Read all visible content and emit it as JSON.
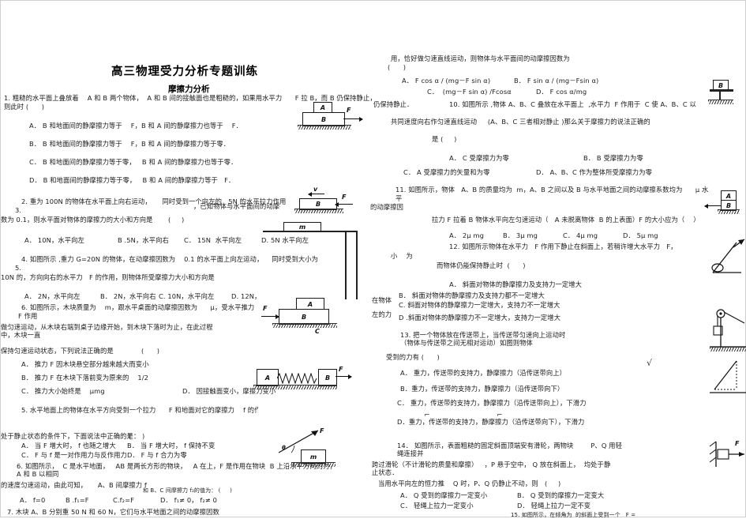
{
  "document": {
    "title": "高三物理受力分析专题训练",
    "subtitle": "摩擦力分析"
  },
  "left_column": {
    "q1": {
      "stem_line1": "1. 粗糙的水平面上叠放着    A 和 B 两个物体，  A 和 B 间的接触面也是粗糙的，如果用水平力      F 拉 B，而 B 仍保持静止，",
      "stem_line2": "则此时 (      )",
      "options": [
        "A． B 和地面间的静摩擦力等于    F，B 和 A 间的静摩擦力也等于    F．",
        "B． B 和地面间的静摩擦力等于    F，B 和 A 间的静摩擦力等于零．",
        "C． B 和地面间的静摩擦力等于零，   B 和 A 间的静摩擦力也等于零．",
        "D． B 和地面间的静摩擦力等于零，   B 和 A 间的静摩擦力等于   F．"
      ]
    },
    "q2": {
      "stem_line1": "2. 重为 100N 的物体在水平面上向右运动，     同时受到一个向左的   5N 的水平拉力作用",
      "stem_line2": "3.",
      "stem_line3": "数为 0.1，则水平面对物体的摩擦力的大小和方向是",
      "stem_paren": "(     )",
      "stem_tail": "，已知物体与水平面间的动摩擦因",
      "options": [
        "A． 10N，水平向左",
        "B .5N，水平向右",
        "C． 15N  水平向左",
        "D. 5N 水平向左"
      ]
    },
    "q4": {
      "stem_line1": "4. 如图所示 ,重力 G=20N 的物体，在动摩擦因数为    0.1 的水平面上向左运动，    同时受到大小为",
      "stem_line2": "5.",
      "stem_line3": "10N 的，方向向右的水平力   F 的作用，则物体所受摩擦力大小和方向是",
      "options": [
        "A． 2N，水平向左",
        "B． 2N，水平向右",
        "C. 10N，水平向左",
        "D. 12N，"
      ]
    },
    "q6a": {
      "stem_line1": "6. 如图所示，木块质量为    m，跟水平桌面的动摩擦因数为      μ，受水平推力",
      "stem_line2": "F 作用",
      "stem_line3": "做匀速运动，从木块右端到桌子边缘开始，到木块下落时为止，在此过程",
      "stem_line4": "中，木块一直",
      "stem_line5": "保持匀速运动状态，下列说法正确的是",
      "stem_paren": "(      )",
      "options": [
        "A． 推力 F 因木块悬空部分越来越大而变小",
        "B． 推力 F 在木块下落前变为原来的    1/2",
        "C． 推力大小始终是    μmg",
        "D． 因接触面变小，摩擦力变小"
      ]
    },
    "q5": {
      "stem_line1": "5. 水平地面上的物体在水平方向受到一个拉力      F 和地面对它的摩擦力    f 的作用．",
      "stem_line2": "处于静止状态的条件下，下面说法中正确的是：",
      "stem_paren": "(     )",
      "options": [
        "A． 当 F 增大时， f 也随之增大",
        "B． 当 F 增大时， f 保持不变",
        "C． F 与 f 是一对作用力与反作用力",
        "D． F 与 f 合力为零"
      ]
    },
    "q6b": {
      "stem_line1": "6. 如图所示，  C 是水平地面，   AB 是两长方形的物块，   A 在上，F 是作用在物块  B 上沿水平方向的力，物块",
      "stem_line2": "A 和 B 以相同",
      "stem_line3": "的速度匀速运动，由此可知，     A、B 间摩擦力 f",
      "stem_line4": "和 B、C 间摩擦力 f₂的值为： (     )",
      "options": [
        "A． f=0",
        "B .f₁=F",
        "C.f₂=F",
        "D． f₁≠ 0， f₂≠ 0"
      ]
    },
    "q7": {
      "stem_line1": "7. 木块 A、B 分别重 50 N 和 60 N，它们与水平地面之间的动摩擦因数"
    }
  },
  "right_column": {
    "q9": {
      "stem_line1": "用，恰好做匀速直线运动，则物体与水平面间的动摩擦因数为",
      "stem_paren": "(      )",
      "options": [
        "A． F cos α / (mg－F sin α)",
        "B． F sin α / (mg－Fsin α)",
        "C．  (mg－F sin α) /Fcosα",
        "D． F cos α/mg"
      ]
    },
    "q9_tail": "仍保持静止．",
    "q10": {
      "stem_line1": "10. 如图所示 ,物体 A、B、C 叠放在水平面上  ,水平力  F 作用于  C 使 A、B、C 以",
      "stem_line2": "共同速度向右作匀速直线运动     (A、B、C 三者相对静止 )那么关于摩擦力的说法正确的",
      "stem_line3": "是 (     )",
      "options": [
        "A． C 受摩擦力为零",
        "B． B 受摩擦力为零",
        "C． A 受摩擦力的矢量和为零",
        "D． A、B、C 作为整体所受摩擦力为零"
      ]
    },
    "q11": {
      "stem_line1": "11. 如图所示，物体   A、B 的质量均为  m，A、B 之间以及 B 与水平地面之间的动摩擦系数均为      μ 水",
      "stem_line2": "平",
      "stem_line3": "的动摩擦因",
      "stem_line4": "拉力 F 拉着 B 物体水平向左匀速运动（   A 未脱离物体  B 的上表面）F 的大小应为（    ）",
      "options": [
        "A． 2μ mg",
        "B． 3μ mg",
        "C． 4μ mg",
        "D． 5μ mg"
      ]
    },
    "q12": {
      "stem_line1": "12. 如图所示物体在水平力   F 作用下静止在斜面上，若稍许增大水平力   F，",
      "stem_line2": "小    为",
      "stem_line3": "而物体仍能保持静止时  (      )",
      "options": [
        "A． 斜面对物体的静摩擦力及支持力一定增大",
        "B． 斜面对物体的静摩擦力及支持力都不一定增大",
        "C. 斜面对物体的静摩擦力一定增大，支持力不一定增大",
        "D .斜面对物体的静摩擦力不一定增大，支持力一定增大"
      ]
    },
    "q13": {
      "stem_line1": "13. 把一个物体放在传送带上，当传送带匀速向上运动时",
      "stem_line2": "（物体与传送带之间无相对运动）如图则物体",
      "stem_line3": "受到的力有 (      )",
      "options": [
        "A． 重力，传送带的支持力，静摩擦力（沿传送带向上）",
        "B．重力，传送带的支持力，静摩擦力（沿传送带向下）",
        "C． 重力，传送带的支持力，静摩擦力（沿传送带向上），下滑力",
        "D．重力，传送带的支持力，静摩擦力（沿传送带向下），下滑力"
      ]
    },
    "q13_side1": "在物体",
    "q13_side2": "左的力",
    "q14": {
      "stem_line1": "14． 如图所示，表面粗糙的固定斜面顶端安有滑轮，两物块        P、Q 用轻",
      "stem_line2": "绳连接并",
      "stem_line3": "跨过滑轮（不计滑轮的质量和摩擦）   ，P 悬于空中， Q 放在斜面上，  均处于静",
      "stem_line4": "止状态．",
      "stem_line5": "当用水平向左的恒力推    Q 时，P、Q 仍静止不动，则   (     )",
      "options": [
        "A． Q 受到的摩擦力一定变小",
        "B． Q 受到的摩擦力一定变大",
        "C． 轻绳上拉力一定变小",
        "D． 轻绳上拉力一定不变"
      ]
    },
    "q15": {
      "stem_line1": "的斜面上受到一个   F =",
      "stem_line2": "的 ,",
      "stem_line3": "15. 如图所示，在倾角为"
    }
  },
  "diagrams": {
    "d1": {
      "a": "A",
      "b": "B",
      "f": "F"
    },
    "d2": {
      "b": "B",
      "f": "F",
      "v": "v"
    },
    "d3": {
      "m": "m"
    },
    "d4": {
      "a": "A",
      "b": "B",
      "c": "C",
      "f": "F"
    },
    "d5": {
      "a": "A",
      "b": "B",
      "f": "F"
    },
    "d6": {
      "m": "m",
      "f": "F",
      "theta": "θ"
    },
    "d7": {
      "b": "B",
      "f": "F"
    },
    "d8": {
      "a": "A",
      "b": "B"
    }
  }
}
